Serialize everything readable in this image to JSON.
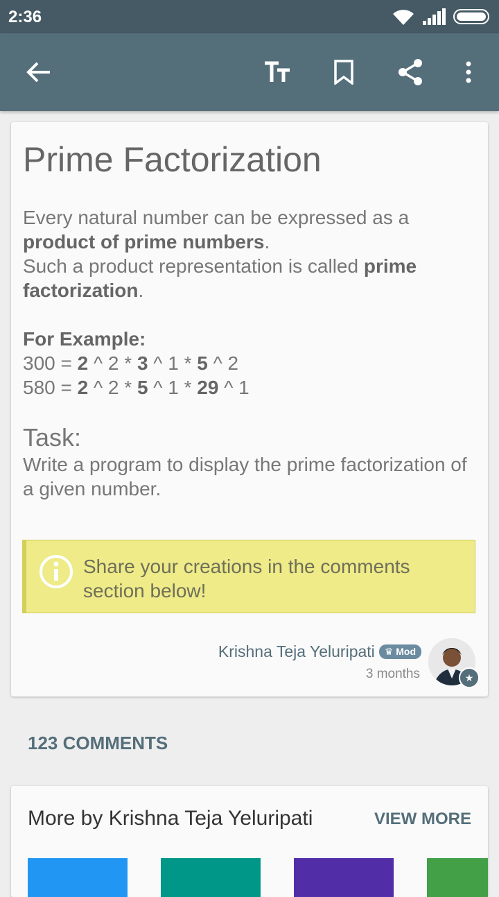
{
  "status": {
    "time": "2:36"
  },
  "article": {
    "title": "Prime Factorization",
    "intro_plain": "Every natural number can be expressed as a ",
    "intro_bold": "product of prime numbers",
    "intro_end": ".",
    "line2_plain": "Such a product representation is called ",
    "line2_bold": "prime factorization",
    "line2_end": ".",
    "example_label": "For Example:",
    "ex1": {
      "num": "300 = ",
      "f1": "2",
      "e1": " ^ 2 * ",
      "f2": "3",
      "e2": " ^ 1 * ",
      "f3": "5",
      "e3": " ^ 2"
    },
    "ex2": {
      "num": "580 = ",
      "f1": "2",
      "e1": " ^ 2 * ",
      "f2": "5",
      "e2": " ^ 1 * ",
      "f3": "29",
      "e3": " ^ 1"
    },
    "task_heading": "Task:",
    "task_text": "Write a program to display the prime factorization of a given number."
  },
  "info": {
    "message": "Share your creations in the comments section below!"
  },
  "author": {
    "name": "Krishna Teja Yeluripati",
    "badge": "Mod",
    "time_ago": "3 months"
  },
  "comments": {
    "label": "123 COMMENTS"
  },
  "more": {
    "title": "More by Krishna Teja Yeluripati",
    "view_more": "VIEW MORE"
  },
  "colors": {
    "appbar": "#546e7a",
    "statusbar": "#455a64",
    "info_bg": "#eeeb88",
    "tiles": [
      "#2196f3",
      "#009688",
      "#512da8",
      "#43a047"
    ]
  }
}
